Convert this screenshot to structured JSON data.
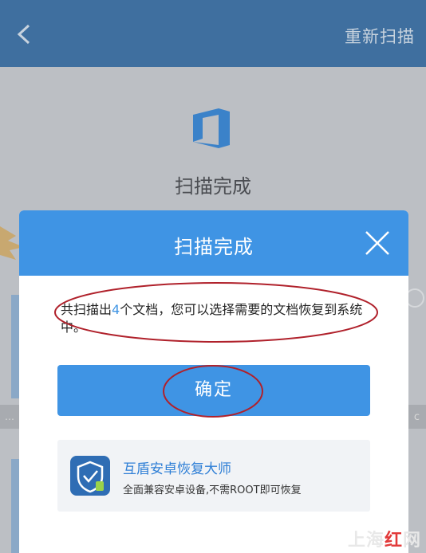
{
  "header": {
    "rescan_label": "重新扫描"
  },
  "background": {
    "title": "扫描完成",
    "strip_left": "…",
    "strip_right": "c"
  },
  "dialog": {
    "title": "扫描完成",
    "message_prefix": "共扫描出",
    "message_count": "4",
    "message_suffix": "个文档，您可以选择需要的文档恢复到系统中。",
    "confirm_label": "确定",
    "promo": {
      "name": "互盾安卓恢复大师",
      "description": "全面兼容安卓设备,不需ROOT即可恢复"
    }
  },
  "watermark": {
    "part1": "上海",
    "part2": "红",
    "part3": "网"
  },
  "colors": {
    "accent": "#3f94e4",
    "topbar": "#3f6f9f",
    "annotation": "#b0212b"
  }
}
